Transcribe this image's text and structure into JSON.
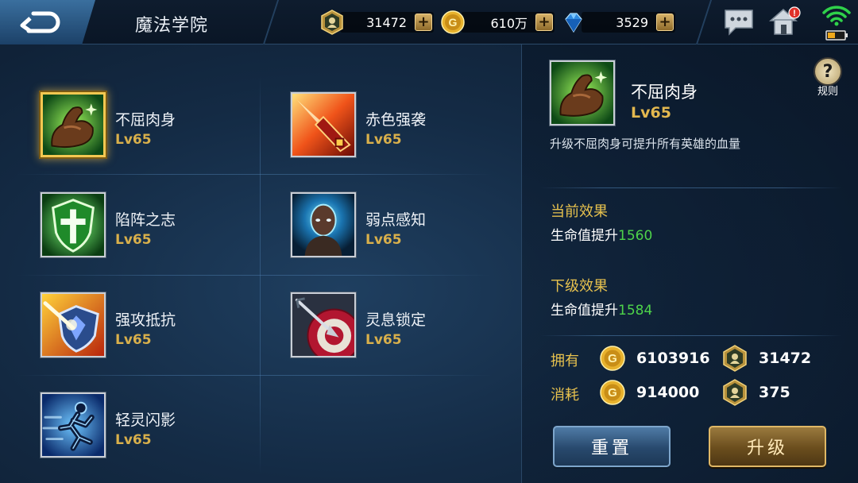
{
  "header": {
    "title": "魔法学院",
    "resources": [
      {
        "icon": "hero-token-icon",
        "value": "31472"
      },
      {
        "icon": "gold-coin-icon",
        "value": "610万"
      },
      {
        "icon": "diamond-icon",
        "value": "3529"
      }
    ],
    "plus_label": "+"
  },
  "skills": [
    {
      "name": "不屈肉身",
      "level": "Lv65",
      "icon": "muscle-arm-icon",
      "selected": true
    },
    {
      "name": "赤色强袭",
      "level": "Lv65",
      "icon": "red-blade-icon",
      "selected": false
    },
    {
      "name": "陷阵之志",
      "level": "Lv65",
      "icon": "cross-shield-icon",
      "selected": false
    },
    {
      "name": "弱点感知",
      "level": "Lv65",
      "icon": "glowing-head-icon",
      "selected": false
    },
    {
      "name": "强攻抵抗",
      "level": "Lv65",
      "icon": "fire-shield-icon",
      "selected": false
    },
    {
      "name": "灵息锁定",
      "level": "Lv65",
      "icon": "target-arrow-icon",
      "selected": false
    },
    {
      "name": "轻灵闪影",
      "level": "Lv65",
      "icon": "running-man-icon",
      "selected": false
    }
  ],
  "detail": {
    "help_label": "规则",
    "name": "不屈肉身",
    "level": "Lv65",
    "description": "升级不屈肉身可提升所有英雄的血量",
    "current": {
      "title": "当前效果",
      "text": "生命值提升",
      "value": "1560"
    },
    "next": {
      "title": "下级效果",
      "text": "生命值提升",
      "value": "1584"
    },
    "owned": {
      "label": "拥有",
      "gold": "6103916",
      "token": "31472"
    },
    "cost": {
      "label": "消耗",
      "gold": "914000",
      "token": "375"
    },
    "reset_label": "重置",
    "upgrade_label": "升级"
  },
  "colors": {
    "level_gold": "#d9b04b",
    "effect_value_green": "#4ed34a",
    "selected_border": "#f3c851"
  }
}
